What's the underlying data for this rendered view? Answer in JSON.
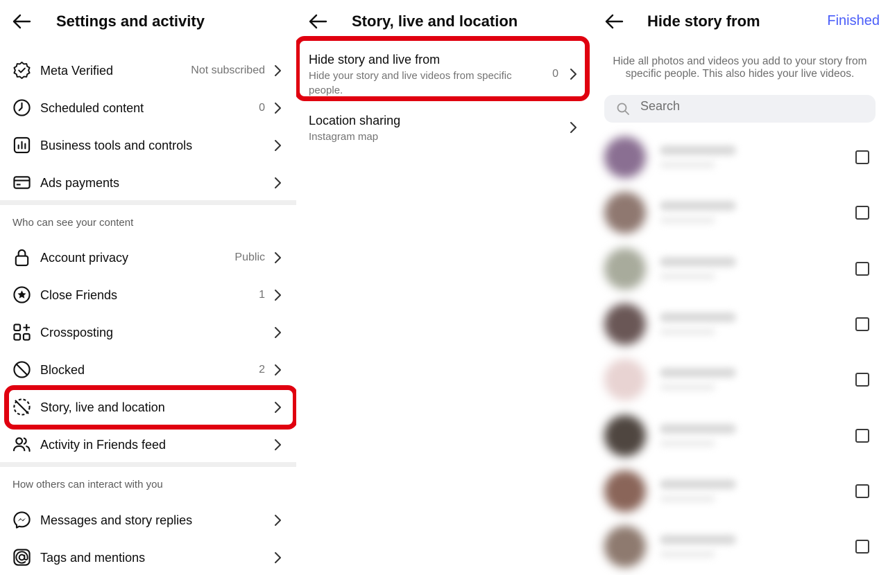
{
  "panel1": {
    "title": "Settings and activity",
    "top_items": [
      {
        "label": "Meta Verified",
        "value": "Not subscribed",
        "icon": "verified-badge-icon"
      },
      {
        "label": "Scheduled content",
        "value": "0",
        "icon": "clock-icon"
      },
      {
        "label": "Business tools and controls",
        "value": "",
        "icon": "bar-chart-icon"
      },
      {
        "label": "Ads payments",
        "value": "",
        "icon": "credit-card-icon"
      }
    ],
    "section1": "Who can see your content",
    "content_items": [
      {
        "label": "Account privacy",
        "value": "Public",
        "icon": "lock-icon"
      },
      {
        "label": "Close Friends",
        "value": "1",
        "icon": "star-circle-icon"
      },
      {
        "label": "Crossposting",
        "value": "",
        "icon": "grid-plus-icon"
      },
      {
        "label": "Blocked",
        "value": "2",
        "icon": "blocked-icon"
      },
      {
        "label": "Story, live and location",
        "value": "",
        "icon": "story-location-icon"
      },
      {
        "label": "Activity in Friends feed",
        "value": "",
        "icon": "people-icon"
      }
    ],
    "section2": "How others can interact with you",
    "interact_items": [
      {
        "label": "Messages and story replies",
        "value": "",
        "icon": "messenger-icon"
      },
      {
        "label": "Tags and mentions",
        "value": "",
        "icon": "at-icon"
      }
    ]
  },
  "panel2": {
    "title": "Story, live and location",
    "items": [
      {
        "title": "Hide story and live from",
        "subtitle": "Hide your story and live videos from specific people.",
        "value": "0"
      },
      {
        "title": "Location sharing",
        "subtitle": "Instagram map",
        "value": ""
      }
    ]
  },
  "panel3": {
    "title": "Hide story from",
    "action": "Finished",
    "description": "Hide all photos and videos you add to your story from specific people. This also hides your live videos.",
    "search_placeholder": "Search",
    "avatar_colors": [
      "#8a6f92",
      "#8f7870",
      "#a8ab9c",
      "#6a5756",
      "#e8d3d2",
      "#4f4640",
      "#8a6559",
      "#8e7a6f"
    ]
  },
  "colors": {
    "highlight": "#e0000f",
    "accent": "#4a5df9"
  }
}
